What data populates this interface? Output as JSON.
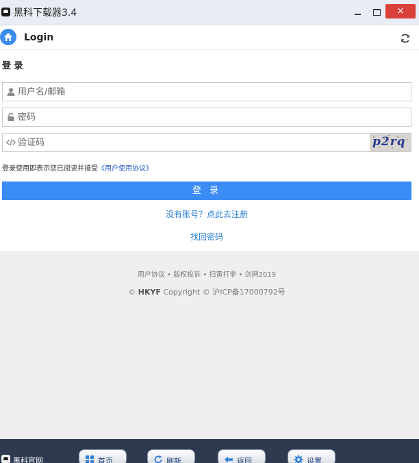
{
  "window": {
    "title": "黑科下载器3.4",
    "close_glyph": "×",
    "controls": [
      "minimize-icon",
      "maximize-icon",
      "close-icon"
    ]
  },
  "header": {
    "title": "Login",
    "left_icon": "home-icon",
    "right_icon": "refresh-icon"
  },
  "form": {
    "section_title": "登 录",
    "username": {
      "placeholder": "用户名/邮箱",
      "value": "",
      "icon": "user-icon"
    },
    "password": {
      "placeholder": "密码",
      "value": "",
      "icon": "lock-icon"
    },
    "captcha": {
      "placeholder": "验证码",
      "value": "",
      "icon": "code-icon",
      "image_text": "p2rq"
    },
    "agreement_prefix": "登录使用即表示您已阅读并接受",
    "agreement_link": "《用户使用协议》",
    "login_button": "登 录",
    "register_link": "没有账号？点此去注册",
    "forgot_link": "找回密码"
  },
  "footer": {
    "links": "用户协议 • 版权投诉 • 扫黄打非 • 剑网2019",
    "copyright_prefix": "©",
    "brand": "HKYF",
    "copyright_suffix": "Copyright © 沪ICP备17000792号"
  },
  "bottombar": {
    "site_label": "黑科官网",
    "buttons": [
      {
        "label": "首页",
        "icon": "grid-icon"
      },
      {
        "label": "刷新",
        "icon": "refresh-icon"
      },
      {
        "label": "返回",
        "icon": "back-arrow-icon"
      },
      {
        "label": "设置",
        "icon": "gear-icon"
      }
    ]
  },
  "colors": {
    "primary": "#3b8cf5",
    "link": "#2b7fd4",
    "close_button": "#d9413a",
    "bottom_bar": "#2d3a50"
  }
}
